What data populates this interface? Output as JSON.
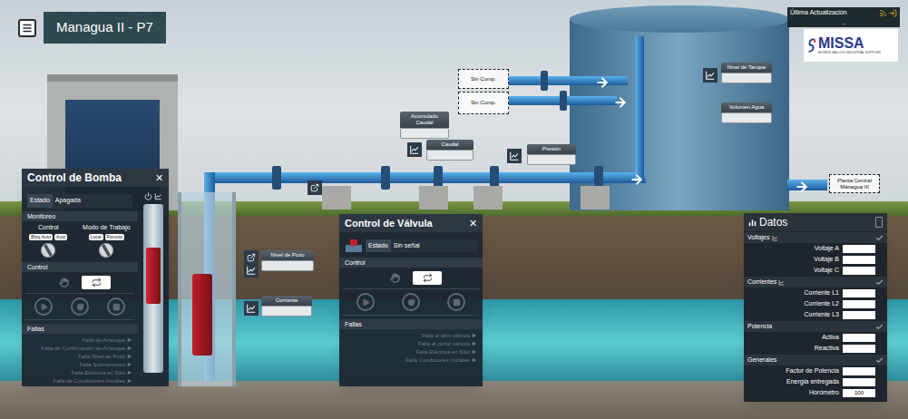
{
  "header": {
    "title": "Managua II - P7"
  },
  "update": {
    "label": "Última Actualización",
    "value": "-"
  },
  "logo": {
    "name": "MISSA",
    "subtitle": "MORRIS SALLICK INDUSTRIAL SUPPLIES"
  },
  "tags": [
    {
      "label": "Sin Comp."
    },
    {
      "label": "Sin Comp."
    },
    {
      "label": "Planta Central Managua III"
    }
  ],
  "readouts": [
    {
      "label": "Acumulado Caudal",
      "value": ""
    },
    {
      "label": "Caudal",
      "value": ""
    },
    {
      "label": "Presión",
      "value": ""
    },
    {
      "label": "Nivel de Tanque",
      "value": ""
    },
    {
      "label": "Volumen Agua",
      "value": ""
    },
    {
      "label": "Nivel de Pozo",
      "value": ""
    },
    {
      "label": "Corriente",
      "value": ""
    }
  ],
  "pump_panel": {
    "title": "Control de Bomba",
    "close": "✕",
    "status_label": "Estado",
    "status": "Apagada",
    "monitor_label": "Monitoreo",
    "groups": [
      {
        "label": "Control",
        "buttons": [
          "Bloq.Auto",
          "Auto"
        ]
      },
      {
        "label": "Modo de Trabajo",
        "buttons": [
          "Local",
          "Remoto"
        ]
      }
    ],
    "control_label": "Control",
    "modes": [
      {
        "selected": false
      },
      {
        "selected": true
      }
    ],
    "actions": [
      {
        "disabled": true
      },
      {
        "disabled": true
      },
      {
        "disabled": true
      }
    ],
    "faults_label": "Fallas",
    "faults": [
      {
        "label": "Falla de Arranque",
        "active": false
      },
      {
        "label": "Falla de Confirmación de Arranque",
        "active": false
      },
      {
        "label": "Falla Nivel de Pozo",
        "active": false
      },
      {
        "label": "Falla Sobrepresión",
        "active": false
      },
      {
        "label": "Falla Eléctrica en Sitio",
        "active": false
      },
      {
        "label": "Falla de Condiciones Iniciales",
        "active": false
      }
    ]
  },
  "valve_panel": {
    "title": "Control de Válvula",
    "close": "✕",
    "status_label": "Estado",
    "status": "Sin señal",
    "control_label": "Control",
    "modes": [
      {
        "selected": false
      },
      {
        "selected": true
      }
    ],
    "actions": [
      {
        "disabled": true
      },
      {
        "disabled": true
      },
      {
        "disabled": true
      }
    ],
    "faults_label": "Fallas",
    "faults": [
      {
        "label": "Falla al abrir válvula",
        "active": false
      },
      {
        "label": "Falla al cerrar válvula",
        "active": false
      },
      {
        "label": "Falla Eléctrica en Sitio",
        "active": false
      },
      {
        "label": "Falla Condiciones Iniciales",
        "active": false
      }
    ]
  },
  "datos": {
    "title": "Datos",
    "sections": [
      {
        "label": "Voltajes",
        "checked": true,
        "rows": [
          {
            "label": "Voltaje A",
            "value": ""
          },
          {
            "label": "Voltaje B",
            "value": ""
          },
          {
            "label": "Voltaje C",
            "value": ""
          }
        ]
      },
      {
        "label": "Corrientes",
        "checked": true,
        "rows": [
          {
            "label": "Corriente L1",
            "value": ""
          },
          {
            "label": "Corriente L2",
            "value": ""
          },
          {
            "label": "Corriente L3",
            "value": ""
          }
        ]
      },
      {
        "label": "Potencia",
        "checked": true,
        "rows": [
          {
            "label": "Activa",
            "value": ""
          },
          {
            "label": "Reactiva",
            "value": ""
          }
        ]
      },
      {
        "label": "Generales",
        "checked": true,
        "rows": [
          {
            "label": "Factor de Potencia",
            "value": ""
          },
          {
            "label": "Energía entregada",
            "value": ""
          },
          {
            "label": "Horómetro",
            "value": "100"
          }
        ]
      }
    ]
  }
}
